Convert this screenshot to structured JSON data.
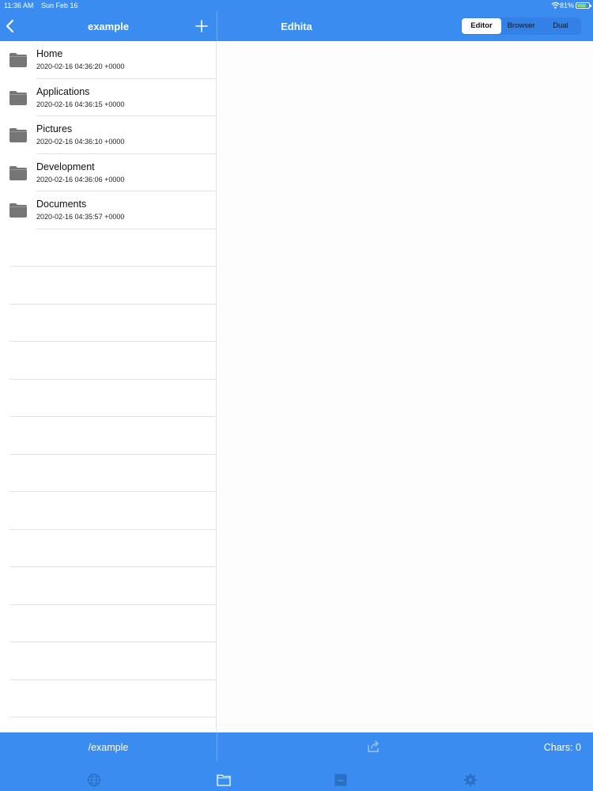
{
  "status_bar": {
    "time": "11:36 AM",
    "date": "Sun Feb 16",
    "battery": "81%"
  },
  "nav": {
    "folder_title": "example",
    "app_title": "Edhita",
    "segments": [
      "Editor",
      "Browser",
      "Dual"
    ],
    "active_segment": "Editor"
  },
  "files": [
    {
      "name": "Home",
      "modified": "2020-02-16 04:36:20 +0000",
      "icon": "folder-icon"
    },
    {
      "name": "Applications",
      "modified": "2020-02-16 04:36:15 +0000",
      "icon": "folder-icon"
    },
    {
      "name": "Pictures",
      "modified": "2020-02-16 04:36:10 +0000",
      "icon": "folder-icon"
    },
    {
      "name": "Development",
      "modified": "2020-02-16 04:36:06 +0000",
      "icon": "folder-icon"
    },
    {
      "name": "Documents",
      "modified": "2020-02-16 04:35:57 +0000",
      "icon": "folder-icon"
    }
  ],
  "bottom_bar": {
    "path": "/example",
    "chars": "Chars: 0"
  },
  "tabs": [
    {
      "icon": "globe-icon"
    },
    {
      "icon": "folder-icon",
      "active": true
    },
    {
      "icon": "editor-icon"
    },
    {
      "icon": "gear-icon"
    }
  ],
  "colors": {
    "accent": "#3a8cf0",
    "folder": "#767676",
    "separator": "#e3e3e6"
  }
}
